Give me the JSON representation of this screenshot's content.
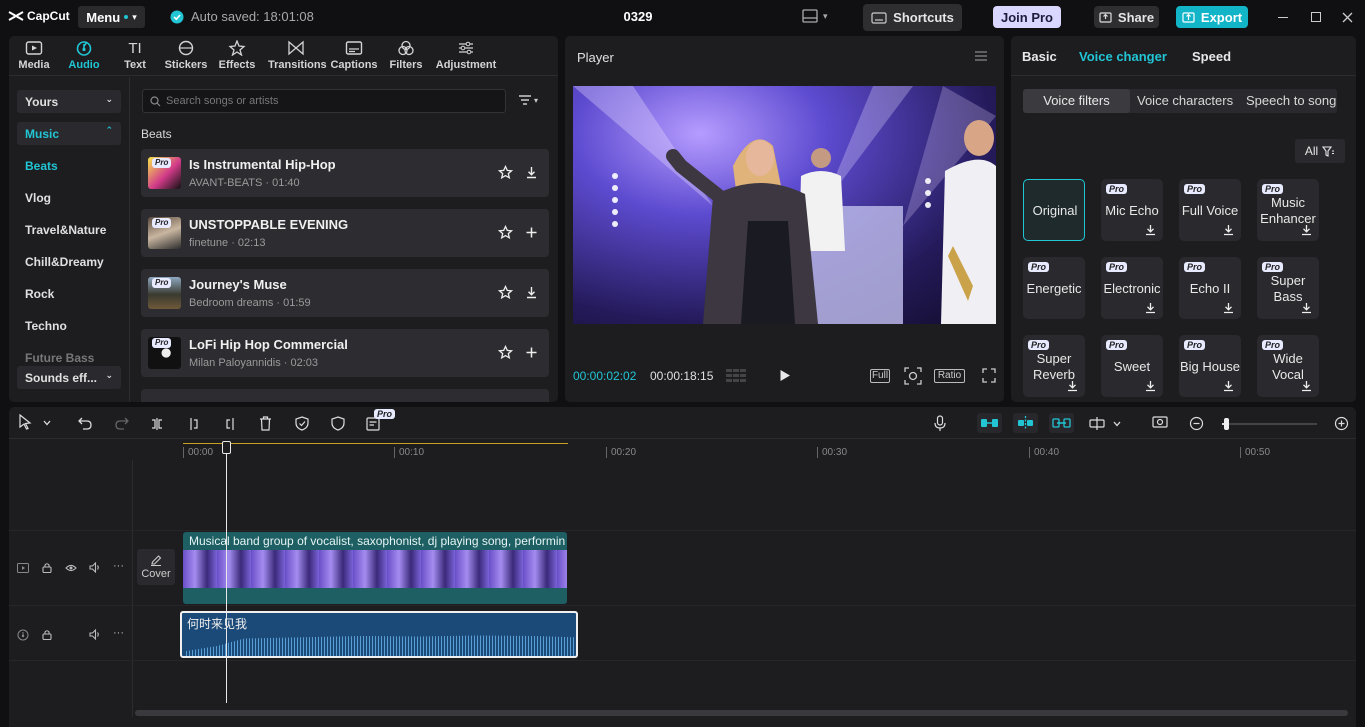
{
  "app": {
    "logo_text": "CapCut",
    "menu_label": "Menu",
    "autosave": "Auto saved: 18:01:08",
    "project_name": "0329"
  },
  "topbar": {
    "shortcuts": "Shortcuts",
    "join_pro": "Join Pro",
    "share": "Share",
    "export": "Export"
  },
  "tabs": [
    {
      "label": "Media",
      "icon": "media-icon"
    },
    {
      "label": "Audio",
      "icon": "audio-icon",
      "active": true
    },
    {
      "label": "Text",
      "icon": "text-icon"
    },
    {
      "label": "Stickers",
      "icon": "stickers-icon"
    },
    {
      "label": "Effects",
      "icon": "effects-icon"
    },
    {
      "label": "Transitions",
      "icon": "transitions-icon"
    },
    {
      "label": "Captions",
      "icon": "captions-icon"
    },
    {
      "label": "Filters",
      "icon": "filters-icon"
    },
    {
      "label": "Adjustment",
      "icon": "adjustment-icon"
    }
  ],
  "sidebar": {
    "yours": "Yours",
    "music": "Music",
    "categories": [
      "Beats",
      "Vlog",
      "Travel&Nature",
      "Chill&Dreamy",
      "Rock",
      "Techno",
      "Future Bass"
    ],
    "sounds": "Sounds eff..."
  },
  "library": {
    "search_placeholder": "Search songs or artists",
    "section": "Beats",
    "tracks": [
      {
        "title": "Is Instrumental Hip-Hop",
        "meta": "AVANT-BEATS · 01:40",
        "pro": "Pro"
      },
      {
        "title": "UNSTOPPABLE EVENING",
        "meta": "finetune · 02:13",
        "pro": "Pro"
      },
      {
        "title": "Journey's Muse",
        "meta": "Bedroom dreams · 01:59",
        "pro": "Pro"
      },
      {
        "title": "LoFi Hip Hop Commercial",
        "meta": "Milan Paloyannidis · 02:03",
        "pro": "Pro"
      }
    ]
  },
  "player": {
    "title": "Player",
    "current_time": "00:00:02:02",
    "total_time": "00:00:18:15",
    "full": "Full",
    "ratio": "Ratio"
  },
  "right_panel": {
    "tabs": [
      "Basic",
      "Voice changer",
      "Speed"
    ],
    "active_tab": "Voice changer",
    "subtabs": [
      "Voice filters",
      "Voice characters",
      "Speech to song"
    ],
    "filter_all": "All",
    "pro_badge": "Pro",
    "effects": [
      {
        "name": "Original",
        "pro": false
      },
      {
        "name": "Mic Echo",
        "pro": true
      },
      {
        "name": "Full Voice",
        "pro": true
      },
      {
        "name": "Music Enhancer",
        "pro": true
      },
      {
        "name": "Energetic",
        "pro": true
      },
      {
        "name": "Electronic",
        "pro": true
      },
      {
        "name": "Echo II",
        "pro": true
      },
      {
        "name": "Super Bass",
        "pro": true
      },
      {
        "name": "Super Reverb",
        "pro": true
      },
      {
        "name": "Sweet",
        "pro": true
      },
      {
        "name": "Big House",
        "pro": true
      },
      {
        "name": "Wide Vocal",
        "pro": true
      }
    ]
  },
  "timeline": {
    "pro_badge": "Pro",
    "ruler": [
      "00:00",
      "00:10",
      "00:20",
      "00:30",
      "00:40",
      "00:50"
    ],
    "video_clip_label": "Musical band group of vocalist, saxophonist, dj playing song, performin",
    "audio_clip_label": "何时来见我",
    "cover_label": "Cover"
  },
  "colors": {
    "accent": "#21c5d4",
    "export": "#12b5c8",
    "joinpro": "#d9d6ff",
    "audio_clip": "#1c4a78",
    "video_clip": "#1d5f63"
  }
}
